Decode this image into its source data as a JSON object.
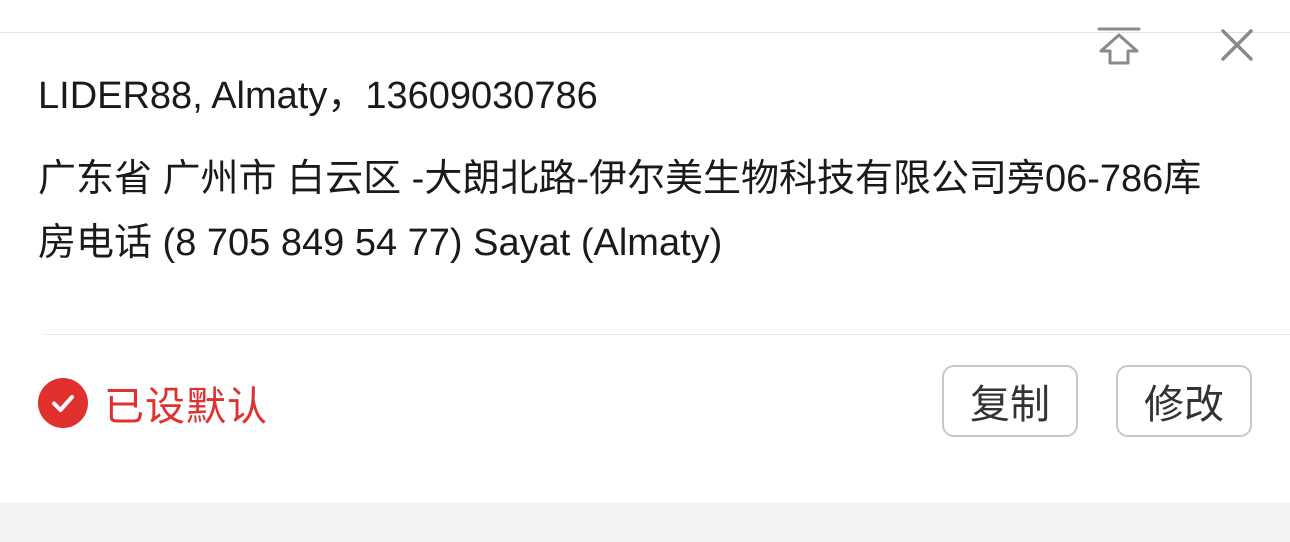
{
  "address": {
    "name_line": "LIDER88, Almaty，13609030786",
    "detail": "广东省 广州市 白云区 -大朗北路-伊尔美生物科技有限公司旁06-786库房电话 (8 705 849 54 77) Sayat (Almaty)"
  },
  "footer": {
    "default_label": "已设默认",
    "copy_label": "复制",
    "edit_label": "修改"
  },
  "icons": {
    "pin_top": "pin-to-top-icon",
    "close": "close-icon",
    "default_check": "check-circle-icon"
  },
  "colors": {
    "accent_red": "#e0312e",
    "text_dark": "#1a1a1a",
    "icon_gray": "#8a8a8a",
    "button_border": "#c8c8c8",
    "page_bg": "#f2f2f2"
  }
}
